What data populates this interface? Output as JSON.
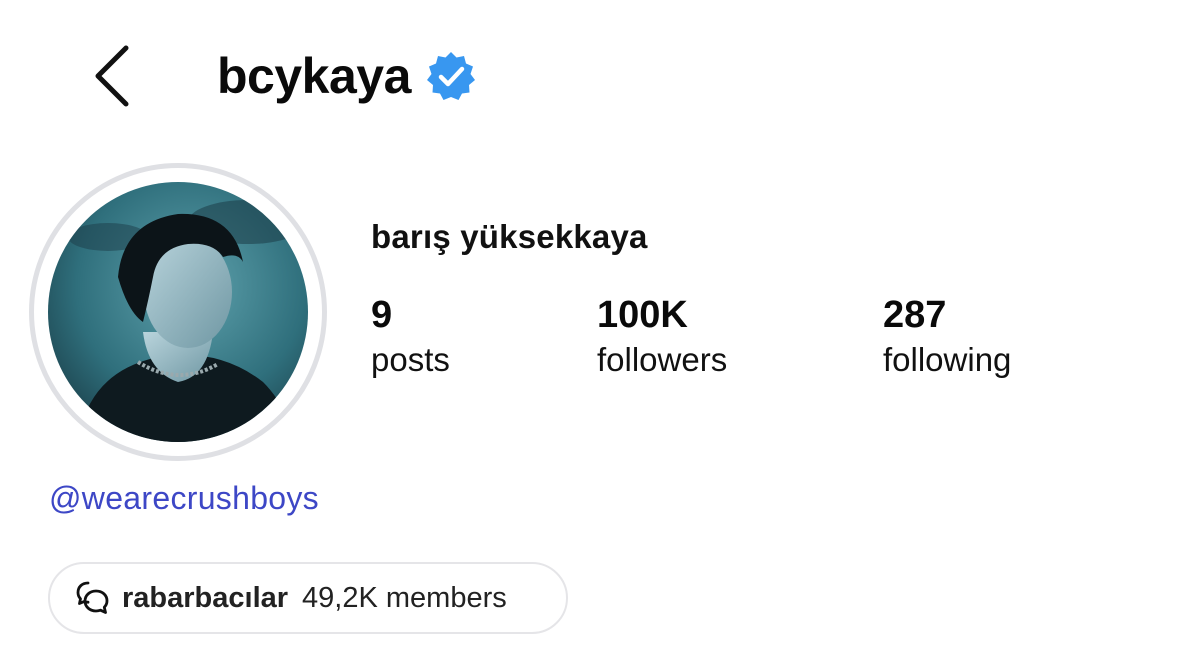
{
  "header": {
    "back_icon": "chevron-left-icon",
    "username": "bcykaya",
    "verified_icon": "verified-badge-icon",
    "verified_color": "#3897f0"
  },
  "profile": {
    "full_name": "barış yüksekkaya",
    "avatar_ring_color": "#dfe0e4",
    "stats": {
      "posts": {
        "value": "9",
        "label": "posts"
      },
      "followers": {
        "value": "100K",
        "label": "followers"
      },
      "following": {
        "value": "287",
        "label": "following"
      }
    },
    "linked_account": "@wearecrushboys",
    "link_color": "#3d47c6"
  },
  "channel": {
    "icon": "chat-bubbles-icon",
    "name": "rabarbacılar",
    "members": "49,2K members"
  }
}
